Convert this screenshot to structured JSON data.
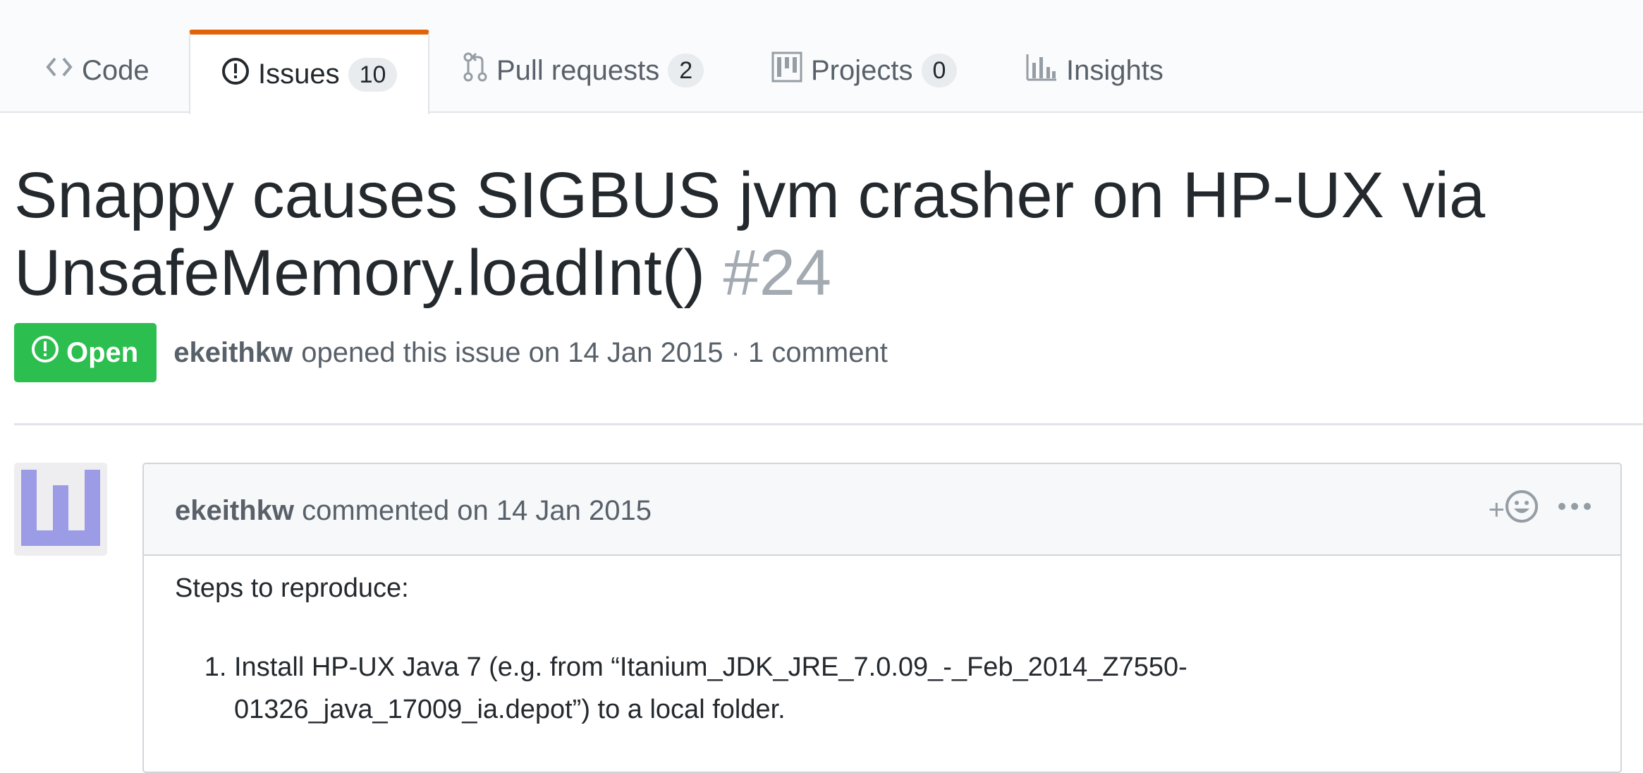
{
  "tabs": [
    {
      "label": "Code",
      "icon": "code-icon"
    },
    {
      "label": "Issues",
      "icon": "issue-opened-icon",
      "count": "10",
      "selected": true
    },
    {
      "label": "Pull requests",
      "icon": "git-pull-request-icon",
      "count": "2"
    },
    {
      "label": "Projects",
      "icon": "project-icon",
      "count": "0"
    },
    {
      "label": "Insights",
      "icon": "graph-icon"
    }
  ],
  "issue": {
    "title": "Snappy causes SIGBUS jvm crasher on HP-UX via UnsafeMemory.loadInt()",
    "number": "#24",
    "state": "Open",
    "author": "ekeithkw",
    "opened_text": "opened this issue on 14 Jan 2015 · 1 comment"
  },
  "comment": {
    "author": "ekeithkw",
    "timestamp_text": "commented on 14 Jan 2015",
    "reaction_label": "+",
    "body_intro": "Steps to reproduce:",
    "steps": [
      "Install HP-UX Java 7 (e.g. from “Itanium_JDK_JRE_7.0.09_-_Feb_2014_Z7550-01326_java_17009_ia.depot”) to a local folder."
    ]
  },
  "colors": {
    "open_green": "#2cbe4e",
    "selected_tab_accent": "#e36209",
    "avatar_identicon": "#9b9be6"
  }
}
